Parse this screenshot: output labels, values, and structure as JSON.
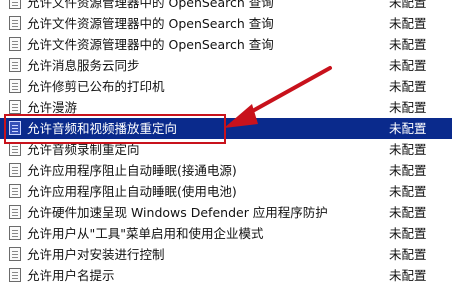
{
  "policies": [
    {
      "name": "允许文件资源管理器中的 OpenSearch 查询",
      "state": "未配置"
    },
    {
      "name": "允许文件资源管理器中的 OpenSearch 查询",
      "state": "未配置"
    },
    {
      "name": "允许文件资源管理器中的 OpenSearch 查询",
      "state": "未配置"
    },
    {
      "name": "允许消息服务云同步",
      "state": "未配置"
    },
    {
      "name": "允许修剪已公布的打印机",
      "state": "未配置"
    },
    {
      "name": "允许漫游",
      "state": "未配置"
    },
    {
      "name": "允许音频和视频播放重定向",
      "state": "未配置",
      "selected": true
    },
    {
      "name": "允许音频录制重定向",
      "state": "未配置"
    },
    {
      "name": "允许应用程序阻止自动睡眠(接通电源)",
      "state": "未配置"
    },
    {
      "name": "允许应用程序阻止自动睡眠(使用电池)",
      "state": "未配置"
    },
    {
      "name": "允许硬件加速呈现 Windows Defender 应用程序防护",
      "state": "未配置"
    },
    {
      "name": "允许用户从\"工具\"菜单启用和使用企业模式",
      "state": "未配置"
    },
    {
      "name": "允许用户对安装进行控制",
      "state": "未配置"
    },
    {
      "name": "允许用户名提示",
      "state": "未配置"
    }
  ],
  "colors": {
    "selection": "#0a2a8c",
    "annotation": "#c8121c"
  },
  "icons": {
    "row_icon": "policy-setting-icon",
    "annotation": "red-arrow-icon"
  }
}
